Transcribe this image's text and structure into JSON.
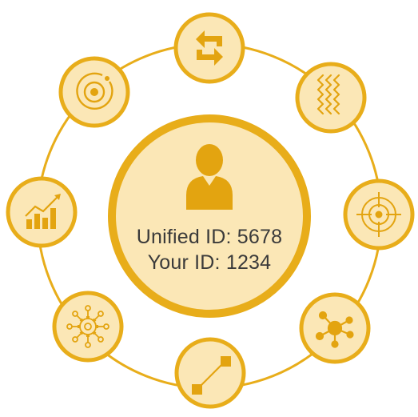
{
  "center": {
    "unified_id": "Unified ID: 5678",
    "your_id": "Your ID: 1234",
    "icon": "user-icon"
  },
  "colors": {
    "ring": "#e8ad1a",
    "fill": "#fbe7b6",
    "icon": "#e3a410",
    "text": "#3a3a3a"
  },
  "satellites": [
    {
      "name": "sync-arrows-icon"
    },
    {
      "name": "wavy-lines-icon"
    },
    {
      "name": "target-crosshair-icon"
    },
    {
      "name": "network-hub-icon"
    },
    {
      "name": "line-connection-icon"
    },
    {
      "name": "gear-network-icon"
    },
    {
      "name": "bar-chart-growth-icon"
    },
    {
      "name": "orbit-icon"
    }
  ]
}
